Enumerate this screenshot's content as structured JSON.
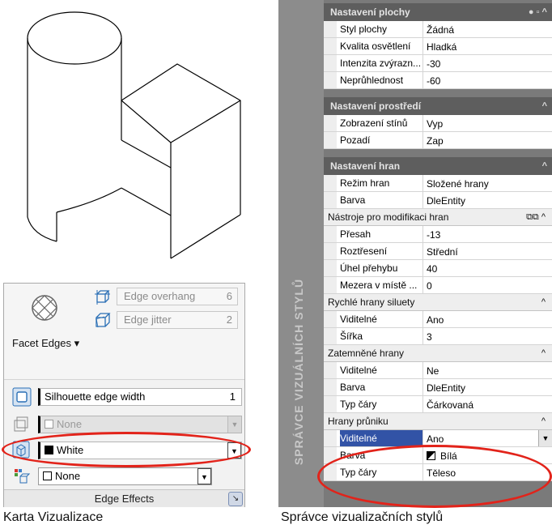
{
  "ribbon": {
    "facet_edges_label": "Facet Edges",
    "edge_overhang_label": "Edge overhang",
    "edge_overhang_value": "6",
    "edge_jitter_label": "Edge jitter",
    "edge_jitter_value": "2",
    "silhouette_label": "Silhouette edge width",
    "silhouette_value": "1",
    "obscured_color": "None",
    "intersection_color": "White",
    "fourth_color": "None",
    "panel_title": "Edge Effects"
  },
  "palette": {
    "vertical_title": "SPRÁVCE VIZUÁLNÍCH STYLŮ",
    "sections": [
      {
        "title": "Nastavení plochy",
        "style": "dark",
        "controls": "● ▫ ^",
        "rows": [
          {
            "k": "Styl plochy",
            "v": "Žádná"
          },
          {
            "k": "Kvalita osvětlení",
            "v": "Hladká"
          },
          {
            "k": "Intenzita zvýrazn...",
            "v": "-30"
          },
          {
            "k": "Neprůhlednost",
            "v": "-60"
          }
        ]
      },
      {
        "title": "Nastavení prostředí",
        "style": "dark",
        "controls": "^",
        "rows": [
          {
            "k": "Zobrazení stínů",
            "v": "Vyp"
          },
          {
            "k": "Pozadí",
            "v": "Zap"
          }
        ]
      },
      {
        "title": "Nastavení hran",
        "style": "dark",
        "controls": "^",
        "rows": [
          {
            "k": "Režim hran",
            "v": "Složené hrany"
          },
          {
            "k": "Barva",
            "v": "DleEntity"
          }
        ]
      },
      {
        "title": "Nástroje pro modifikaci hran",
        "style": "light",
        "controls": "⧉⧉ ^",
        "rows": [
          {
            "k": "Přesah",
            "v": "-13"
          },
          {
            "k": "Roztřesení",
            "v": "Střední"
          },
          {
            "k": "Úhel přehybu",
            "v": "40"
          },
          {
            "k": "Mezera v místě ...",
            "v": "0"
          }
        ]
      },
      {
        "title": "Rychlé hrany siluety",
        "style": "light",
        "controls": "^",
        "rows": [
          {
            "k": "Viditelné",
            "v": "Ano"
          },
          {
            "k": "Šířka",
            "v": "3"
          }
        ]
      },
      {
        "title": "Zatemněné hrany",
        "style": "light",
        "controls": "^",
        "rows": [
          {
            "k": "Viditelné",
            "v": "Ne"
          },
          {
            "k": "Barva",
            "v": "DleEntity"
          },
          {
            "k": "Typ čáry",
            "v": "Čárkovaná"
          }
        ]
      },
      {
        "title": "Hrany průniku",
        "style": "light",
        "controls": "^",
        "rows": [
          {
            "k": "Viditelné",
            "v": "Ano",
            "selected": true
          },
          {
            "k": "Barva",
            "v": "Bílá",
            "swatch": true
          },
          {
            "k": "Typ čáry",
            "v": "Těleso"
          }
        ]
      }
    ]
  },
  "captions": {
    "left": "Karta Vizualizace",
    "right": "Správce vizualizačních stylů"
  },
  "colors": {
    "highlight_ring": "#e2231a",
    "selected_row": "#3253a6"
  }
}
